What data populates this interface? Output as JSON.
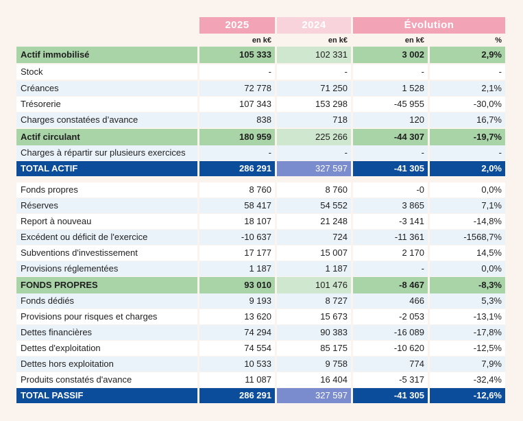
{
  "header": {
    "col_2025": "2025",
    "col_2024": "2024",
    "col_evolution": "Évolution",
    "unit_1": "en k€",
    "unit_2": "en k€",
    "unit_3": "en k€",
    "unit_4": "%"
  },
  "colors": {
    "header_2025": "#f2a3b6",
    "header_2024": "#f8d3dc",
    "header_evolution": "#f2a3b6",
    "subtotal_green": "#a9d4a8",
    "total_navy": "#0b4c9b"
  },
  "rows": [
    {
      "label": "Actif immobilisé",
      "v2025": "105 333",
      "v2024": "102 331",
      "evo": "3 002",
      "pct": "2,9%",
      "style": "subtotal"
    },
    {
      "label": "Stock",
      "v2025": "-",
      "v2024": "-",
      "evo": "-",
      "pct": "-",
      "style": "white"
    },
    {
      "label": "Créances",
      "v2025": "72 778",
      "v2024": "71 250",
      "evo": "1 528",
      "pct": "2,1%",
      "style": "blue"
    },
    {
      "label": "Trésorerie",
      "v2025": "107 343",
      "v2024": "153 298",
      "evo": "-45 955",
      "pct": "-30,0%",
      "style": "white"
    },
    {
      "label": "Charges constatées d’avance",
      "v2025": "838",
      "v2024": "718",
      "evo": "120",
      "pct": "16,7%",
      "style": "blue"
    },
    {
      "label": "Actif circulant",
      "v2025": "180 959",
      "v2024": "225 266",
      "evo": "-44 307",
      "pct": "-19,7%",
      "style": "subtotal"
    },
    {
      "label": "Charges à répartir sur plusieurs exercices",
      "v2025": "-",
      "v2024": "-",
      "evo": "-",
      "pct": "-",
      "style": "blue"
    },
    {
      "label": "TOTAL ACTIF",
      "v2025": "286 291",
      "v2024": "327 597",
      "evo": "-41 305",
      "pct": "2,0%",
      "style": "total"
    },
    {
      "label": "Fonds propres",
      "v2025": "8 760",
      "v2024": "8 760",
      "evo": "-0",
      "pct": "0,0%",
      "style": "white"
    },
    {
      "label": "Réserves",
      "v2025": "58 417",
      "v2024": "54 552",
      "evo": "3 865",
      "pct": "7,1%",
      "style": "blue"
    },
    {
      "label": "Report à nouveau",
      "v2025": "18 107",
      "v2024": "21 248",
      "evo": "-3 141",
      "pct": "-14,8%",
      "style": "white"
    },
    {
      "label": "Excédent ou déficit de l'exercice",
      "v2025": "-10 637",
      "v2024": "724",
      "evo": "-11 361",
      "pct": "-1568,7%",
      "style": "blue"
    },
    {
      "label": "Subventions d'investissement",
      "v2025": "17 177",
      "v2024": "15 007",
      "evo": "2 170",
      "pct": "14,5%",
      "style": "white"
    },
    {
      "label": "Provisions réglementées",
      "v2025": "1 187",
      "v2024": "1 187",
      "evo": "-",
      "pct": "0,0%",
      "style": "blue"
    },
    {
      "label": "FONDS PROPRES",
      "v2025": "93 010",
      "v2024": "101 476",
      "evo": "-8 467",
      "pct": "-8,3%",
      "style": "subtotal"
    },
    {
      "label": "Fonds dédiés",
      "v2025": "9 193",
      "v2024": "8 727",
      "evo": "466",
      "pct": "5,3%",
      "style": "blue"
    },
    {
      "label": "Provisions pour risques et charges",
      "v2025": "13 620",
      "v2024": "15 673",
      "evo": "-2 053",
      "pct": "-13,1%",
      "style": "white"
    },
    {
      "label": "Dettes financières",
      "v2025": "74 294",
      "v2024": "90 383",
      "evo": "-16 089",
      "pct": "-17,8%",
      "style": "blue"
    },
    {
      "label": "Dettes d'exploitation",
      "v2025": "74 554",
      "v2024": "85 175",
      "evo": "-10 620",
      "pct": "-12,5%",
      "style": "white"
    },
    {
      "label": "Dettes hors exploitation",
      "v2025": "10 533",
      "v2024": "9 758",
      "evo": "774",
      "pct": "7,9%",
      "style": "blue"
    },
    {
      "label": "Produits constatés d'avance",
      "v2025": "11 087",
      "v2024": "16 404",
      "evo": "-5 317",
      "pct": "-32,4%",
      "style": "white"
    },
    {
      "label": "TOTAL PASSIF",
      "v2025": "286 291",
      "v2024": "327 597",
      "evo": "-41 305",
      "pct": "-12,6%",
      "style": "total"
    }
  ]
}
